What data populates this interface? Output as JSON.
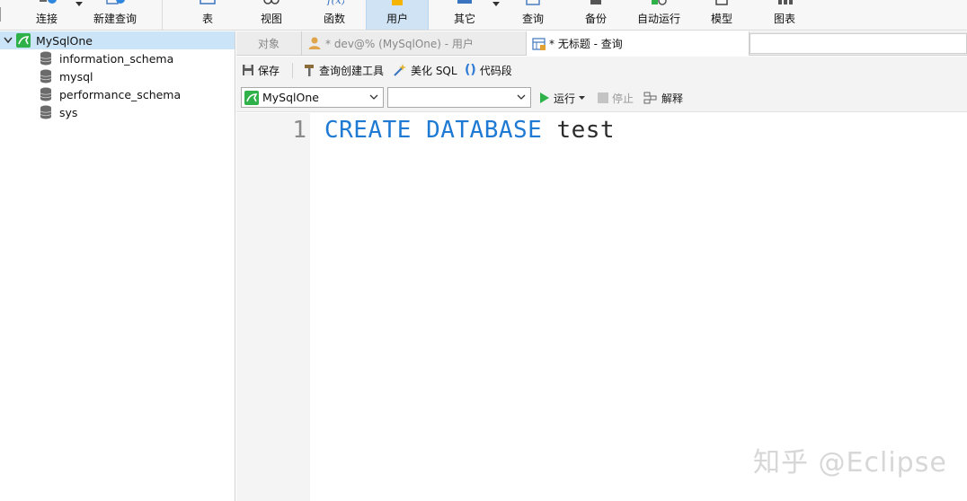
{
  "toolbar": {
    "items": [
      {
        "label": "连接"
      },
      {
        "label": "新建查询"
      },
      {
        "label": "表"
      },
      {
        "label": "视图"
      },
      {
        "label": "函数"
      },
      {
        "label": "用户"
      },
      {
        "label": "其它"
      },
      {
        "label": "查询"
      },
      {
        "label": "备份"
      },
      {
        "label": "自动运行"
      },
      {
        "label": "模型"
      },
      {
        "label": "图表"
      }
    ]
  },
  "nav": {
    "connection": "MySqlOne",
    "databases": [
      "information_schema",
      "mysql",
      "performance_schema",
      "sys"
    ]
  },
  "tabs": {
    "objects": "对象",
    "user_tab": "* dev@% (MySqlOne) - 用户",
    "query_tab": "* 无标题 - 查询"
  },
  "editor_toolbar": {
    "save": "保存",
    "query_builder": "查询创建工具",
    "beautify": "美化 SQL",
    "snippet": "代码段"
  },
  "connbar": {
    "connection_value": "MySqlOne",
    "database_value": "",
    "run": "运行",
    "stop": "停止",
    "explain": "解释"
  },
  "editor": {
    "line_number": "1",
    "kw1": "CREATE",
    "kw2": "DATABASE",
    "ident": "test"
  },
  "watermark": "知乎 @Eclipse",
  "colors": {
    "keyword": "#1f7ad4",
    "selection": "#cce4f7",
    "active_toolbar": "#cfe3f5",
    "connection_icon": "#2fb14a"
  }
}
